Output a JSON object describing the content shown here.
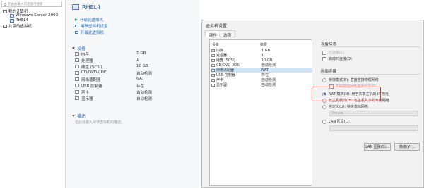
{
  "library": {
    "search_placeholder": "在此处键入内容进行搜索",
    "tree": [
      {
        "label": "我的计算机"
      },
      {
        "label": "Windows Server 2003"
      },
      {
        "label": "RHEL4"
      },
      {
        "label": "共享的虚拟机"
      }
    ]
  },
  "summary": {
    "vm_name": "RHEL4",
    "actions": [
      "开启此虚拟机",
      "编辑虚拟机设置",
      "升级此虚拟机"
    ],
    "devices_heading": "设备",
    "devices": [
      {
        "name": "内存",
        "value": "1 GB",
        "icon": "memory-icon"
      },
      {
        "name": "处理器",
        "value": "1",
        "icon": "cpu-icon"
      },
      {
        "name": "硬盘 (SCSI)",
        "value": "10 GB",
        "icon": "hard-disk-icon"
      },
      {
        "name": "CD/DVD (IDE)",
        "value": "自动检测",
        "icon": "cdrom-icon"
      },
      {
        "name": "网络适配器",
        "value": "NAT",
        "icon": "network-icon"
      },
      {
        "name": "USB 控制器",
        "value": "存在",
        "icon": "usb-icon"
      },
      {
        "name": "声卡",
        "value": "自动检测",
        "icon": "sound-icon"
      },
      {
        "name": "显示器",
        "value": "自动检测",
        "icon": "display-icon"
      }
    ],
    "description_heading": "描述",
    "description_placeholder": "在此处键入对该虚拟机的描述。"
  },
  "dialog": {
    "title": "虚拟机设置",
    "tabs": [
      "硬件",
      "选项"
    ],
    "list_headers": {
      "device": "设备",
      "summary": "摘要"
    },
    "rows": [
      {
        "name": "内存",
        "value": "1 GB",
        "selected": false
      },
      {
        "name": "处理器",
        "value": "1",
        "selected": false
      },
      {
        "name": "硬盘 (SCSI)",
        "value": "10 GB",
        "selected": false
      },
      {
        "name": "CD/DVD (IDE)",
        "value": "自动检测",
        "selected": false
      },
      {
        "name": "网络适配器",
        "value": "NAT",
        "selected": true
      },
      {
        "name": "USB 控制器",
        "value": "存在",
        "selected": false
      },
      {
        "name": "声卡",
        "value": "自动检测",
        "selected": false
      },
      {
        "name": "显示器",
        "value": "自动检测",
        "selected": false
      }
    ],
    "device_status": {
      "heading": "设备状态",
      "connected": "已连接(C)",
      "connect_at_power_on": "启动时连接(O)",
      "connected_checked": false,
      "connect_at_power_on_checked": true
    },
    "network_connection": {
      "heading": "网络连接",
      "bridged": "桥接模式(B): 直接连接物理网络",
      "replicate": "复制物理网络连接状态(P)",
      "nat": "NAT 模式(N): 用于共享主机的 IP 地址",
      "host_only": "仅主机模式(H): 与主机共享的专用网络",
      "custom": "自定义(U): 特定虚拟网络",
      "custom_value": "VMnet0",
      "lan": "LAN 区段(L):",
      "selected": "nat"
    },
    "buttons": {
      "lan_segments": "LAN 区段(S)...",
      "advanced": "高级(V)..."
    }
  },
  "colors": {
    "highlight": "#e53935",
    "accent": "#1f6bc0"
  }
}
